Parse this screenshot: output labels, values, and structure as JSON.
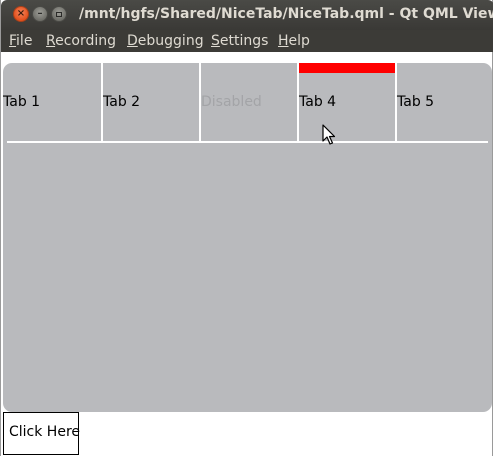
{
  "window": {
    "title": "/mnt/hgfs/Shared/NiceTab/NiceTab.qml - Qt QML Viewer",
    "close_glyph": "×",
    "minimize_glyph": "–"
  },
  "menubar": {
    "items": [
      {
        "mnemonic": "F",
        "rest": "ile"
      },
      {
        "mnemonic": "R",
        "rest": "ecording"
      },
      {
        "mnemonic": "D",
        "rest": "ebugging"
      },
      {
        "mnemonic": "S",
        "rest": "ettings"
      },
      {
        "mnemonic": "H",
        "rest": "elp"
      }
    ]
  },
  "tabview": {
    "tabs": [
      {
        "label": "Tab 1",
        "enabled": true,
        "active": false
      },
      {
        "label": "Tab 2",
        "enabled": true,
        "active": false
      },
      {
        "label": "Disabled",
        "enabled": false,
        "active": false
      },
      {
        "label": "Tab 4",
        "enabled": true,
        "active": true
      },
      {
        "label": "Tab 5",
        "enabled": true,
        "active": false
      }
    ],
    "active_indicator_color": "#ff0000",
    "background_color": "#b9babd"
  },
  "button": {
    "label": "Click Here"
  },
  "cursor": {
    "icon": "arrow-cursor-icon"
  }
}
